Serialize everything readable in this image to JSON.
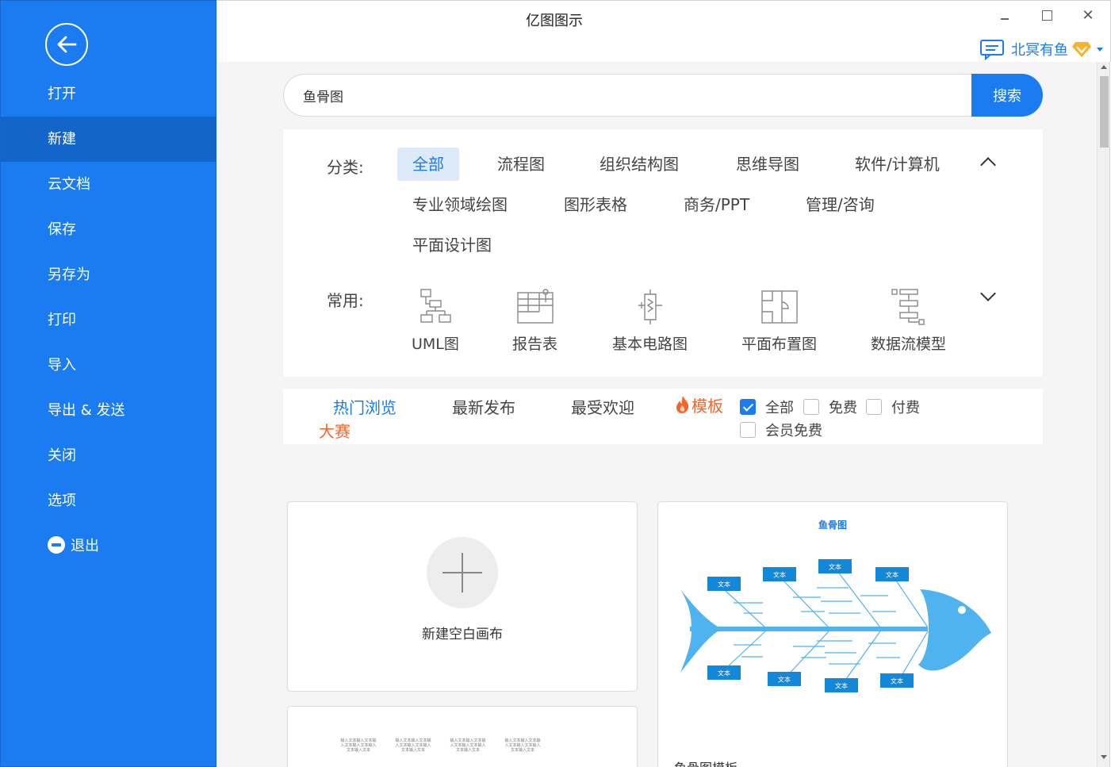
{
  "app": {
    "title": "亿图图示"
  },
  "window": {
    "close_glyph": "✕"
  },
  "user": {
    "name": "北冥有鱼"
  },
  "sidebar": {
    "items": [
      {
        "label": "打开"
      },
      {
        "label": "新建"
      },
      {
        "label": "云文档"
      },
      {
        "label": "保存"
      },
      {
        "label": "另存为"
      },
      {
        "label": "打印"
      },
      {
        "label": "导入"
      },
      {
        "label": "导出 & 发送"
      },
      {
        "label": "关闭"
      },
      {
        "label": "选项"
      },
      {
        "label": "退出"
      }
    ]
  },
  "search": {
    "value": "鱼骨图",
    "button": "搜索"
  },
  "categories": {
    "label": "分类:",
    "items": [
      "全部",
      "流程图",
      "组织结构图",
      "思维导图",
      "软件/计算机",
      "专业领域绘图",
      "图形表格",
      "商务/PPT",
      "管理/咨询",
      "平面设计图"
    ]
  },
  "common": {
    "label": "常用:",
    "items": [
      "UML图",
      "报告表",
      "基本电路图",
      "平面布置图",
      "数据流模型"
    ]
  },
  "filters": {
    "tabs": [
      "热门浏览",
      "最新发布",
      "最受欢迎",
      "大赛"
    ],
    "template_label": "模板",
    "checkboxes": [
      "全部",
      "免费",
      "付费",
      "会员免费"
    ]
  },
  "cards": {
    "blank_label": "新建空白画布",
    "fish_title": "鱼骨图",
    "fish_box": "文本",
    "fish_caption": "鱼骨图模板",
    "mini_text": "输入文本输入文本输入文本输入文本输入文本输入文本"
  }
}
